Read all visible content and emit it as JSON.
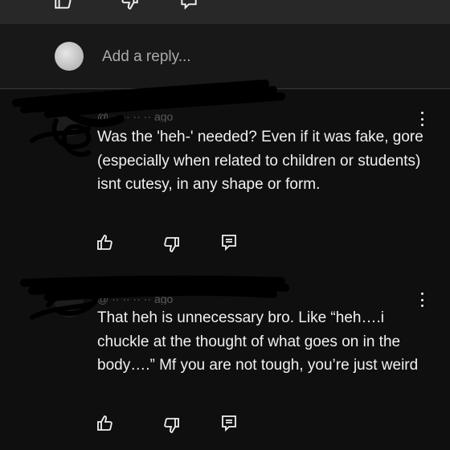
{
  "reply": {
    "placeholder": "Add a reply..."
  },
  "comments": [
    {
      "meta": "@ ·· ·· ·· ·· ago",
      "text": "Was the 'heh-' needed? Even if it was fake, gore (especially when related to children or students) isnt cutesy, in any shape or form."
    },
    {
      "meta": "@ ·· ·· ·· ·· ago",
      "text": "That heh is unnecessary bro. Like “heh….i chuckle at the thought of what goes on in the body….” Mf you are not tough, you’re just weird"
    }
  ],
  "icons": {
    "like": "thumbs-up-icon",
    "dislike": "thumbs-down-icon",
    "reply": "reply-comment-icon",
    "more": "more-vertical-icon"
  },
  "colors": {
    "background": "#0f0f0f",
    "reply_bar": "#181818",
    "text": "#f1f1f1",
    "placeholder": "#aaaaaa"
  }
}
